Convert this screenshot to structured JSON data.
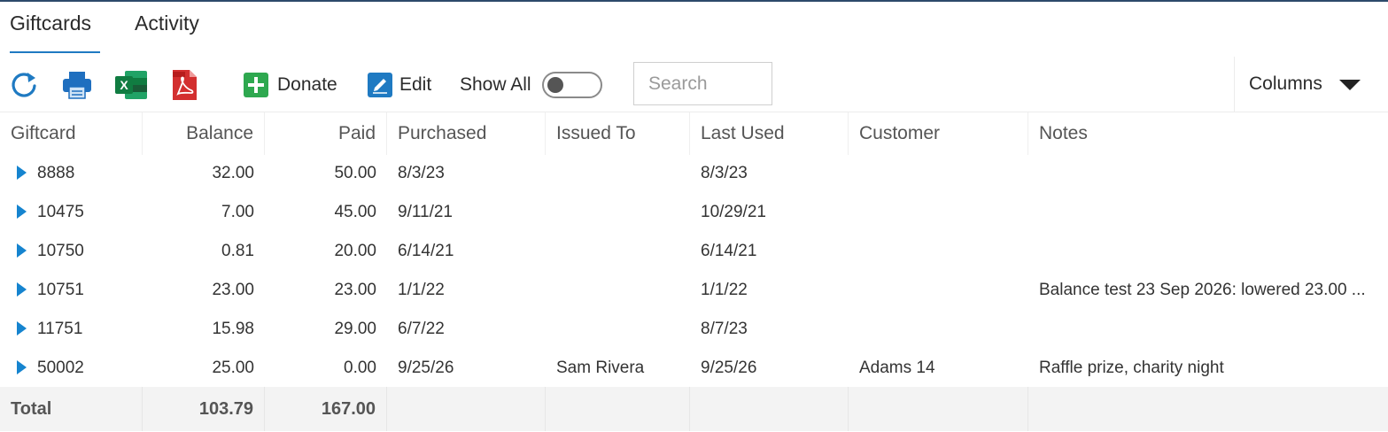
{
  "tabs": [
    {
      "label": "Giftcards",
      "active": true
    },
    {
      "label": "Activity",
      "active": false
    }
  ],
  "toolbar": {
    "icons": [
      "refresh-icon",
      "print-icon",
      "excel-icon",
      "pdf-icon"
    ],
    "donate_label": "Donate",
    "edit_label": "Edit",
    "show_all_label": "Show All",
    "show_all_on": false,
    "search_placeholder": "Search",
    "columns_label": "Columns"
  },
  "colors": {
    "accent": "#1f7ac2",
    "expander": "#1584cf",
    "donate": "#2ea84f",
    "edit": "#1f7ac2"
  },
  "table": {
    "columns": [
      "Giftcard",
      "Balance",
      "Paid",
      "Purchased",
      "Issued To",
      "Last Used",
      "Customer",
      "Notes"
    ],
    "rows": [
      {
        "giftcard": "8888",
        "balance": "32.00",
        "paid": "50.00",
        "purchased": "8/3/23",
        "issued_to": "",
        "last_used": "8/3/23",
        "customer": "",
        "notes": ""
      },
      {
        "giftcard": "10475",
        "balance": "7.00",
        "paid": "45.00",
        "purchased": "9/11/21",
        "issued_to": "",
        "last_used": "10/29/21",
        "customer": "",
        "notes": ""
      },
      {
        "giftcard": "10750",
        "balance": "0.81",
        "paid": "20.00",
        "purchased": "6/14/21",
        "issued_to": "",
        "last_used": "6/14/21",
        "customer": "",
        "notes": ""
      },
      {
        "giftcard": "10751",
        "balance": "23.00",
        "paid": "23.00",
        "purchased": "1/1/22",
        "issued_to": "",
        "last_used": "1/1/22",
        "customer": "",
        "notes": "Balance test 23 Sep 2026: lowered 23.00 ..."
      },
      {
        "giftcard": "11751",
        "balance": "15.98",
        "paid": "29.00",
        "purchased": "6/7/22",
        "issued_to": "",
        "last_used": "8/7/23",
        "customer": "",
        "notes": ""
      },
      {
        "giftcard": "50002",
        "balance": "25.00",
        "paid": "0.00",
        "purchased": "9/25/26",
        "issued_to": "Sam Rivera",
        "last_used": "9/25/26",
        "customer": "Adams 14",
        "notes": "Raffle prize, charity night"
      }
    ],
    "total": {
      "label": "Total",
      "balance": "103.79",
      "paid": "167.00"
    }
  }
}
